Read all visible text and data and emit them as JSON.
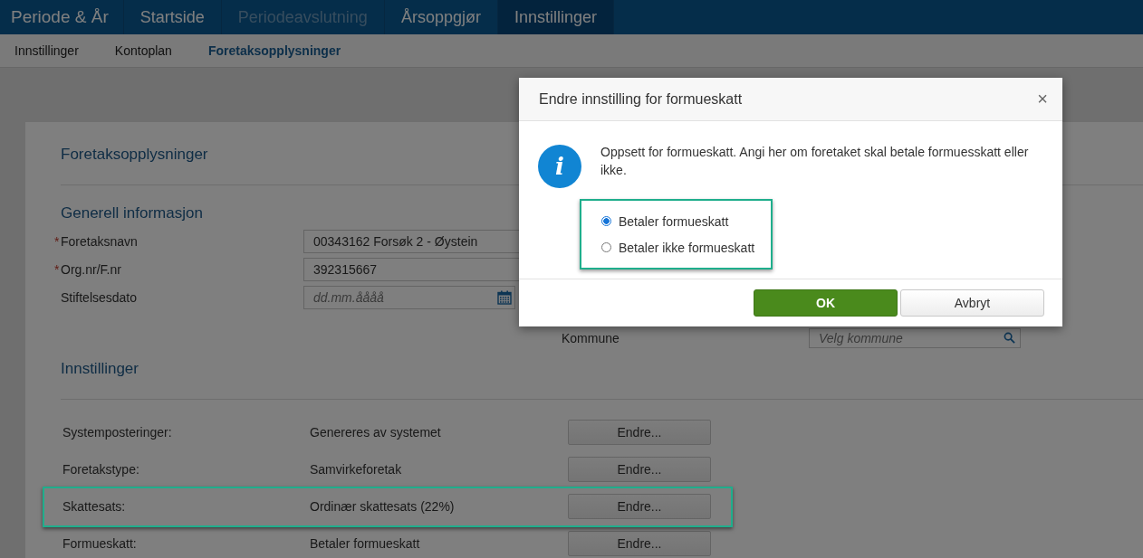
{
  "nav": {
    "brand": "Periode & År",
    "items": [
      {
        "label": "Startside",
        "selected": false,
        "disabled": false
      },
      {
        "label": "Periodeavslutning",
        "selected": false,
        "disabled": true
      },
      {
        "label": "Årsoppgjør",
        "selected": false,
        "disabled": false
      },
      {
        "label": "Innstillinger",
        "selected": true,
        "disabled": false
      }
    ]
  },
  "subnav": [
    {
      "label": "Innstillinger",
      "selected": false
    },
    {
      "label": "Kontoplan",
      "selected": false
    },
    {
      "label": "Foretaksopplysninger",
      "selected": true
    }
  ],
  "card": {
    "title": "Foretaksopplysninger",
    "general": {
      "title": "Generell informasjon",
      "fields": [
        {
          "label": "Foretaksnavn",
          "required_mark": "*",
          "kind": "text",
          "value": "00343162 Forsøk 2 - Øystein"
        },
        {
          "label": "Org.nr/F.nr",
          "required_mark": "*",
          "kind": "text",
          "value": "392315667"
        },
        {
          "label": "Stiftelsesdato",
          "kind": "date",
          "placeholder": "dd.mm.åååå"
        }
      ],
      "kommune": {
        "label": "Kommune",
        "placeholder": "Velg kommune"
      }
    },
    "settings": {
      "title": "Innstillinger",
      "rows": [
        {
          "label": "Systemposteringer:",
          "value": "Genereres av systemet",
          "button": "Endre...",
          "highlighted": false
        },
        {
          "label": "Foretakstype:",
          "value": "Samvirkeforetak",
          "button": "Endre...",
          "highlighted": false
        },
        {
          "label": "Skattesats:",
          "value": "Ordinær skattesats (22%)",
          "button": "Endre...",
          "highlighted": true
        },
        {
          "label": "Formueskatt:",
          "value": "Betaler formueskatt",
          "button": "Endre...",
          "highlighted": false
        }
      ]
    }
  },
  "dialog": {
    "title": "Endre innstilling for formueskatt",
    "close": "×",
    "message": "Oppsett for formueskatt. Angi her om foretaket skal betale formuesskatt eller ikke.",
    "info_glyph": "i",
    "options_highlighted": true,
    "options": [
      {
        "label": "Betaler formueskatt",
        "selected": true
      },
      {
        "label": "Betaler ikke formueskatt",
        "selected": false
      }
    ],
    "buttons": [
      {
        "label": "OK",
        "kind": "primary"
      },
      {
        "label": "Avbryt",
        "kind": "secondary"
      }
    ]
  }
}
